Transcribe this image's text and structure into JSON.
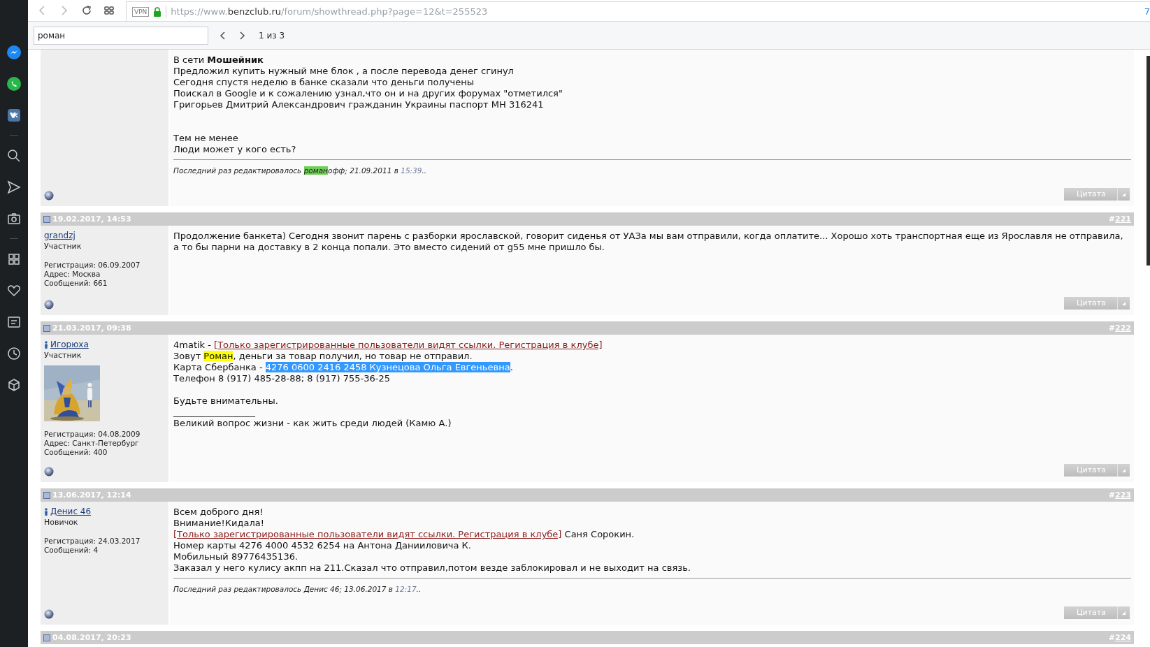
{
  "browser": {
    "vpn_badge": "VPN",
    "url": {
      "scheme": "https://www.",
      "domain": "benzclub.ru",
      "path": "/forum/showthread.php?page=12&t=255523"
    },
    "edge_text": "7"
  },
  "find_bar": {
    "value": "роман",
    "counter": "1 из 3"
  },
  "posts": [
    {
      "lines": [
        {
          "kind": "text",
          "segments": [
            {
              "kind": "plain",
              "text": "В сети **Мошейник**"
            }
          ]
        },
        {
          "kind": "text",
          "segments": [
            {
              "kind": "plain",
              "text": "Предложил купить нужный мне блок , а после перевода денег сгинул"
            }
          ]
        },
        {
          "kind": "text",
          "segments": [
            {
              "kind": "plain",
              "text": "Сегодня спустя неделю в банке сказали что деньги получены"
            }
          ]
        },
        {
          "kind": "text",
          "segments": [
            {
              "kind": "plain",
              "text": "Поискал в Google и к сожалению узнал,что он и на других форумах \"отметился\""
            }
          ]
        },
        {
          "kind": "text",
          "segments": [
            {
              "kind": "plain",
              "text": "Григорьев Дмитрий Александрович гражданин Украины паспорт МН 316241"
            }
          ]
        },
        {
          "kind": "blank"
        },
        {
          "kind": "blank"
        },
        {
          "kind": "text",
          "segments": [
            {
              "kind": "plain",
              "text": "Тем не менее"
            }
          ]
        },
        {
          "kind": "text",
          "segments": [
            {
              "kind": "plain",
              "text": "Люди может у кого есть?"
            }
          ]
        }
      ],
      "edit_note": [
        {
          "kind": "plain",
          "text": "Последний раз редактировалось "
        },
        {
          "kind": "current",
          "text": "роман"
        },
        {
          "kind": "plain",
          "text": "офф; 21.09.2011 в "
        },
        {
          "kind": "time",
          "text": "15:39"
        },
        {
          "kind": "plain",
          "text": ".."
        }
      ],
      "quote_button": {
        "label": "Цитата"
      }
    },
    {
      "header": {
        "date": "19.02.2017, 14:53",
        "hash": "#",
        "number": "221"
      },
      "user": {
        "name": "grandzj",
        "person_icon": false,
        "title": "Участник",
        "details": [
          "Регистрация: 06.09.2007",
          "Адрес: Москва",
          "Сообщений: 661"
        ]
      },
      "lines": [
        {
          "kind": "text",
          "segments": [
            {
              "kind": "plain",
              "text": "Продолжение банкета) Сегодня звонит парень с разборки ярославской, говорит сиденья от УАЗа мы вам отправили, когда оплатите... Хорошо хоть транспортная еще из Ярославля не отправила, а то бы парни на доставку в 2 конца попали. Это вместо сидений от g55 мне пришло бы."
            }
          ]
        }
      ],
      "quote_button": {
        "label": "Цитата"
      }
    },
    {
      "header": {
        "date": "21.03.2017, 09:38",
        "hash": "#",
        "number": "222"
      },
      "user": {
        "name": "Игорюха",
        "person_icon": true,
        "title": "Участник",
        "details": [
          "Регистрация: 04.08.2009",
          "Адрес: Санкт-Петербург",
          "Сообщений: 400"
        ]
      },
      "lines": [
        {
          "kind": "text",
          "segments": [
            {
              "kind": "plain",
              "text": "4matik - "
            },
            {
              "kind": "link",
              "text": "[Только зарегистрированные пользователи видят ссылки. Регистрация в клубе]"
            }
          ]
        },
        {
          "kind": "text",
          "segments": [
            {
              "kind": "plain",
              "text": "Зовут "
            },
            {
              "kind": "match",
              "text": "Роман"
            },
            {
              "kind": "plain",
              "text": ", деньги за товар получил, но товар не отправил."
            }
          ]
        },
        {
          "kind": "text",
          "segments": [
            {
              "kind": "plain",
              "text": "Карта Сбербанка - "
            },
            {
              "kind": "selection",
              "text": "4276 0600 2416 2458 Кузнецова Ольга Евгеньевна"
            },
            {
              "kind": "plain",
              "text": "."
            }
          ]
        },
        {
          "kind": "text",
          "segments": [
            {
              "kind": "plain",
              "text": "Телефон 8 (917) 485-28-88; 8 (917) 755-36-25"
            }
          ]
        },
        {
          "kind": "blank"
        },
        {
          "kind": "text",
          "segments": [
            {
              "kind": "plain",
              "text": "Будьте внимательны."
            }
          ]
        },
        {
          "kind": "text",
          "segments": [
            {
              "kind": "plain",
              "text": "__________________"
            }
          ]
        },
        {
          "kind": "text",
          "segments": [
            {
              "kind": "plain",
              "text": "Великий вопрос жизни - как жить среди людей (Камю А.)"
            }
          ]
        }
      ],
      "quote_button": {
        "label": "Цитата"
      }
    },
    {
      "header": {
        "date": "13.06.2017, 12:14",
        "hash": "#",
        "number": "223"
      },
      "user": {
        "name": "Денис 46",
        "person_icon": true,
        "title": "Новичок",
        "details": [
          "Регистрация: 24.03.2017",
          "Сообщений: 4"
        ]
      },
      "lines": [
        {
          "kind": "text",
          "segments": [
            {
              "kind": "plain",
              "text": "Всем доброго дня!"
            }
          ]
        },
        {
          "kind": "text",
          "segments": [
            {
              "kind": "plain",
              "text": "Внимание!Кидала!"
            }
          ]
        },
        {
          "kind": "text",
          "segments": [
            {
              "kind": "link",
              "text": "[Только зарегистрированные пользователи видят ссылки. Регистрация в клубе]"
            },
            {
              "kind": "plain",
              "text": " Саня Сорокин."
            }
          ]
        },
        {
          "kind": "text",
          "segments": [
            {
              "kind": "plain",
              "text": "Номер карты 4276 4000 4532 6254 на Антона Данииловича К."
            }
          ]
        },
        {
          "kind": "text",
          "segments": [
            {
              "kind": "plain",
              "text": "Мобильный 89776435136."
            }
          ]
        },
        {
          "kind": "text",
          "segments": [
            {
              "kind": "plain",
              "text": "Заказал у него кулису акпп на 211.Сказал что отправил,потом везде заблокировал и не выходит на связь."
            }
          ]
        }
      ],
      "edit_note": [
        {
          "kind": "plain",
          "text": "Последний раз редактировалось Денис 46; 13.06.2017 в "
        },
        {
          "kind": "time",
          "text": "12:17"
        },
        {
          "kind": "plain",
          "text": ".."
        }
      ],
      "quote_button": {
        "label": "Цитата"
      }
    },
    {
      "header": {
        "date": "04.08.2017, 20:23",
        "hash": "#",
        "number": "224"
      }
    }
  ]
}
